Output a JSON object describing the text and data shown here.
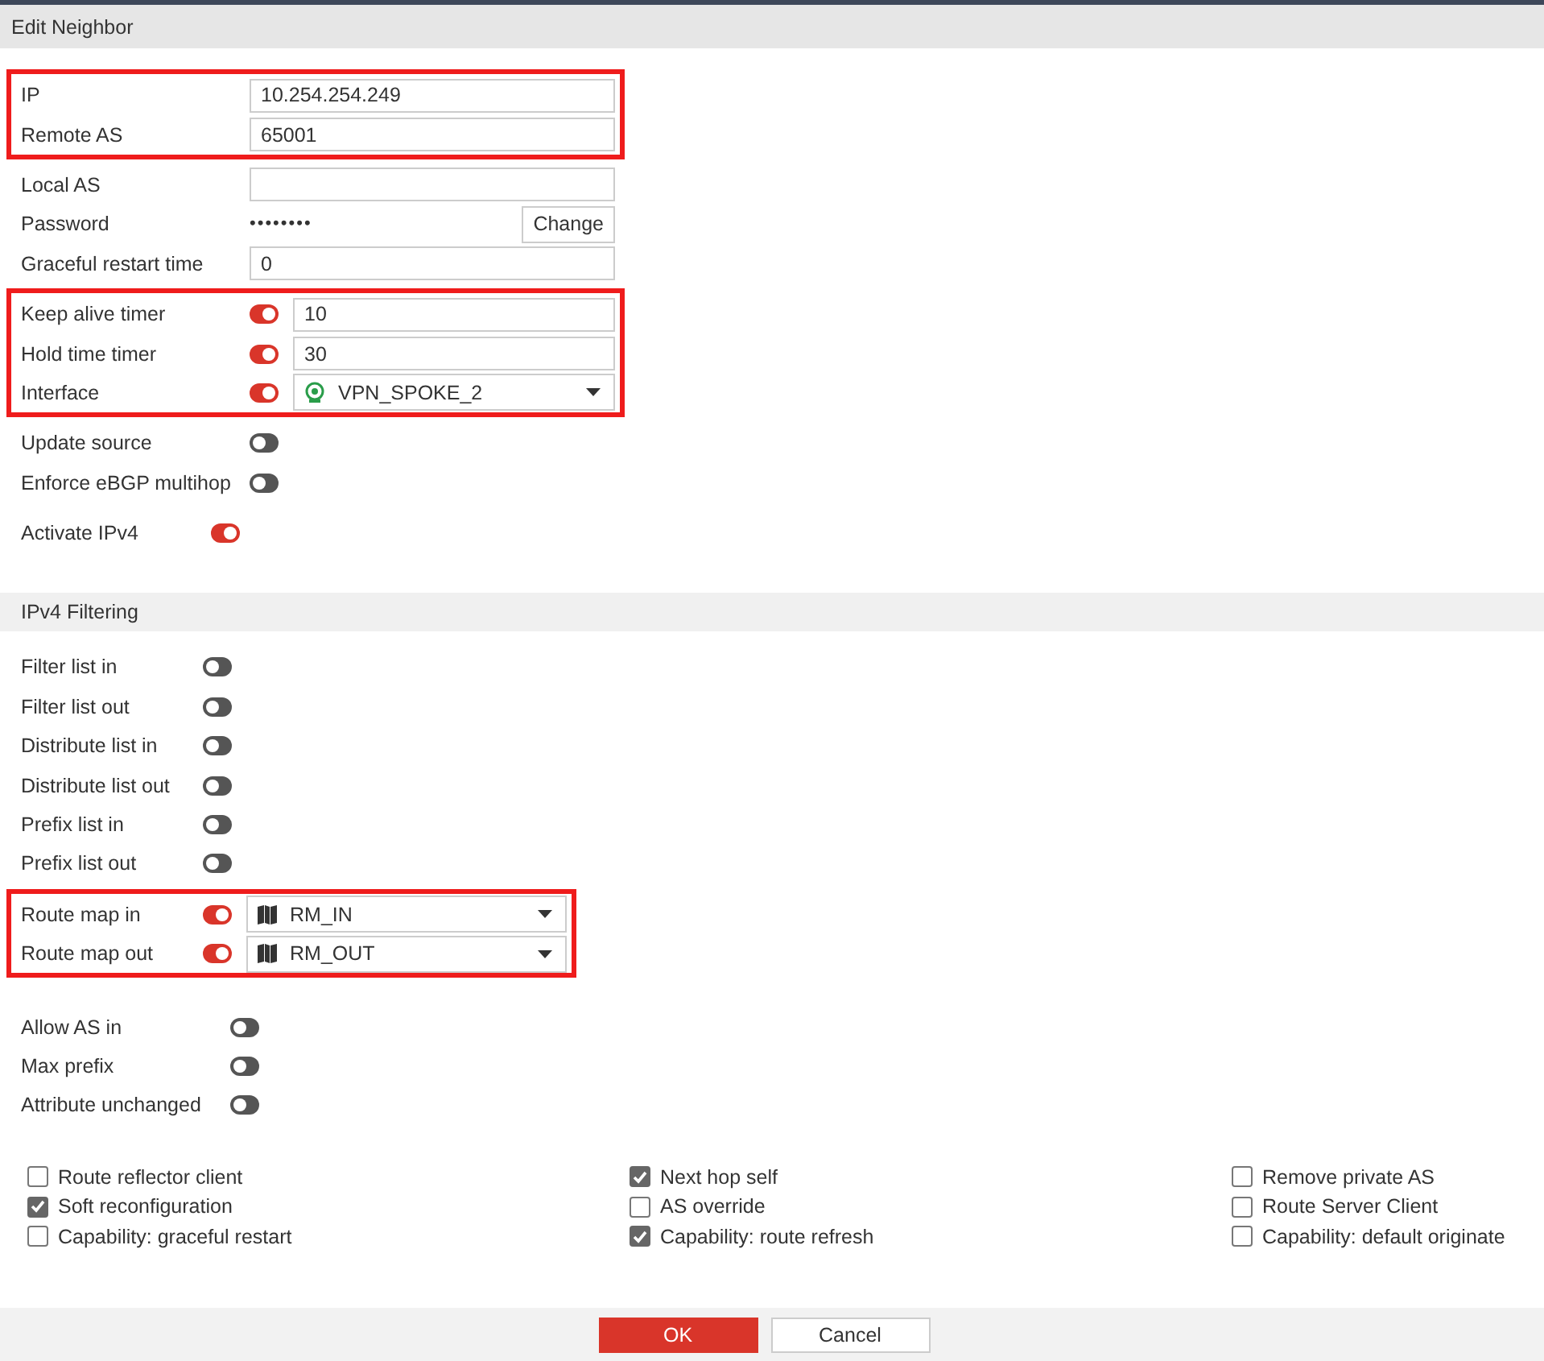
{
  "dialog": {
    "title": "Edit Neighbor"
  },
  "groups": [
    {
      "highlighted": true,
      "rows": [
        {
          "kind": "text",
          "label": "IP",
          "value": "10.254.254.249"
        },
        {
          "kind": "text",
          "label": "Remote AS",
          "value": "65001"
        }
      ]
    },
    {
      "highlighted": false,
      "rows": [
        {
          "kind": "text",
          "label": "Local AS"
        },
        {
          "kind": "password",
          "label": "Password",
          "value": "••••••••",
          "button": "Change"
        },
        {
          "kind": "text",
          "label": "Graceful restart time",
          "value": "0"
        }
      ]
    },
    {
      "highlighted": true,
      "rows": [
        {
          "kind": "toggle_text",
          "label": "Keep alive timer",
          "on": true,
          "value": "10"
        },
        {
          "kind": "toggle_text",
          "label": "Hold time timer",
          "on": true,
          "value": "30"
        },
        {
          "kind": "interface_select",
          "label": "Interface",
          "on": true,
          "value": "VPN_SPOKE_2"
        }
      ]
    },
    {
      "highlighted": false,
      "rows": [
        {
          "kind": "toggle",
          "label": "Update source",
          "on": false
        },
        {
          "kind": "toggle",
          "label": "Enforce eBGP multihop",
          "on": false
        }
      ]
    },
    {
      "highlighted": false,
      "rows": [
        {
          "kind": "toggle",
          "label": "Activate IPv4",
          "on": true
        }
      ]
    }
  ],
  "filtering": {
    "title": "IPv4 Filtering",
    "groups": [
      {
        "highlighted": false,
        "rows": [
          {
            "kind": "toggle",
            "label": "Filter list in",
            "on": false
          },
          {
            "kind": "toggle",
            "label": "Filter list out",
            "on": false
          },
          {
            "kind": "toggle",
            "label": "Distribute list in",
            "on": false
          },
          {
            "kind": "toggle",
            "label": "Distribute list out",
            "on": false
          },
          {
            "kind": "toggle",
            "label": "Prefix list in",
            "on": false
          },
          {
            "kind": "toggle",
            "label": "Prefix list out",
            "on": false
          }
        ]
      },
      {
        "highlighted": true,
        "rows": [
          {
            "kind": "map_select",
            "label": "Route map in",
            "on": true,
            "value": "RM_IN"
          },
          {
            "kind": "map_select",
            "label": "Route map out",
            "on": true,
            "value": "RM_OUT"
          }
        ]
      },
      {
        "highlighted": false,
        "rows": [
          {
            "kind": "toggle",
            "label": "Allow AS in",
            "on": false
          },
          {
            "kind": "toggle",
            "label": "Max prefix",
            "on": false
          },
          {
            "kind": "toggle",
            "label": "Attribute unchanged",
            "on": false
          }
        ]
      }
    ]
  },
  "options": [
    [
      {
        "label": "Route reflector client",
        "checked": false
      },
      {
        "label": "Soft reconfiguration",
        "checked": true
      },
      {
        "label": "Capability: graceful restart",
        "checked": false
      }
    ],
    [
      {
        "label": "Next hop self",
        "checked": true
      },
      {
        "label": "AS override",
        "checked": false
      },
      {
        "label": "Capability: route refresh",
        "checked": true
      }
    ],
    [
      {
        "label": "Remove private AS",
        "checked": false
      },
      {
        "label": "Route Server Client",
        "checked": false
      },
      {
        "label": "Capability: default originate",
        "checked": false
      }
    ]
  ],
  "buttons": [
    {
      "label": "OK",
      "kind": "primary"
    },
    {
      "label": "Cancel",
      "kind": "secondary"
    }
  ]
}
